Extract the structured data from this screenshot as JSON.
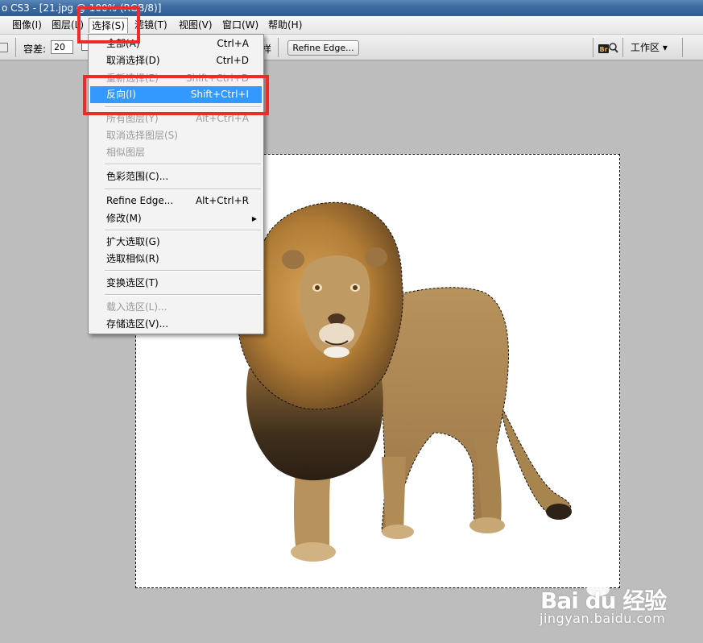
{
  "window": {
    "title": "o CS3 - [21.jpg @ 100% (RGB/8)]"
  },
  "menubar": {
    "items": [
      {
        "label": "图像(I)"
      },
      {
        "label": "图层(L)"
      },
      {
        "label": "选择(S)"
      },
      {
        "label": "滤镜(T)"
      },
      {
        "label": "视图(V)"
      },
      {
        "label": "窗口(W)"
      },
      {
        "label": "帮助(H)"
      }
    ]
  },
  "options": {
    "tolerance_label": "容差:",
    "tolerance_value": "20",
    "trailing_letter": "样",
    "refine_edge_label": "Refine Edge...",
    "workspace_label": "工作区 ▾"
  },
  "select_menu": {
    "items": [
      {
        "label": "全部(A)",
        "shortcut": "Ctrl+A",
        "state": "enabled"
      },
      {
        "label": "取消选择(D)",
        "shortcut": "Ctrl+D",
        "state": "enabled"
      },
      {
        "label": "重新选择(E)",
        "shortcut": "Shift+Ctrl+D",
        "state": "disabled"
      },
      {
        "label": "反向(I)",
        "shortcut": "Shift+Ctrl+I",
        "state": "highlighted"
      },
      {
        "label": "所有图层(Y)",
        "shortcut": "Alt+Ctrl+A",
        "state": "disabled"
      },
      {
        "label": "取消选择图层(S)",
        "shortcut": "",
        "state": "disabled"
      },
      {
        "label": "相似图层",
        "shortcut": "",
        "state": "disabled"
      },
      {
        "label": "色彩范围(C)...",
        "shortcut": "",
        "state": "enabled"
      },
      {
        "label": "Refine Edge...",
        "shortcut": "Alt+Ctrl+R",
        "state": "enabled"
      },
      {
        "label": "修改(M)",
        "shortcut": "",
        "state": "enabled",
        "submenu": true
      },
      {
        "label": "扩大选取(G)",
        "shortcut": "",
        "state": "enabled"
      },
      {
        "label": "选取相似(R)",
        "shortcut": "",
        "state": "enabled"
      },
      {
        "label": "变换选区(T)",
        "shortcut": "",
        "state": "enabled"
      },
      {
        "label": "载入选区(L)...",
        "shortcut": "",
        "state": "disabled"
      },
      {
        "label": "存储选区(V)...",
        "shortcut": "",
        "state": "enabled"
      }
    ]
  },
  "watermark": {
    "brand": "Bai du 经验",
    "url": "jingyan.baidu.com"
  },
  "colors": {
    "highlight": "#3399ff",
    "annotation": "#ee2a2a",
    "workspace_bg": "#bdbdbd"
  }
}
